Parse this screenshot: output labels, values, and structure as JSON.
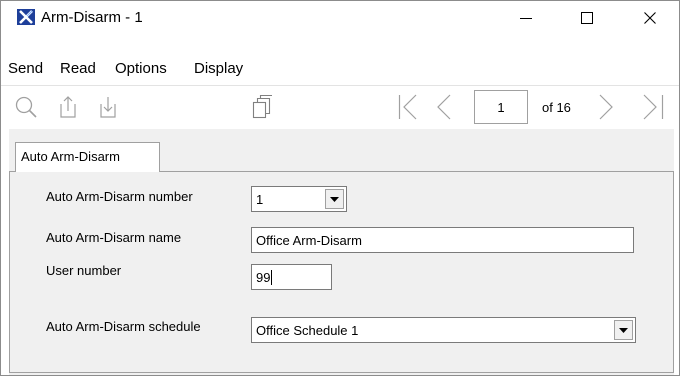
{
  "window": {
    "title": "Arm-Disarm - 1"
  },
  "menu": {
    "items": [
      "Send",
      "Read",
      "Options",
      "Display"
    ]
  },
  "toolbar": {
    "page_value": "1",
    "page_total": "of 16"
  },
  "tab": {
    "label": "Auto Arm-Disarm"
  },
  "form": {
    "number_label": "Auto Arm-Disarm number",
    "number_value": "1",
    "name_label": "Auto Arm-Disarm name",
    "name_value": "Office Arm-Disarm",
    "user_label": "User number",
    "user_value": "99",
    "schedule_label": "Auto Arm-Disarm schedule",
    "schedule_value": "Office Schedule 1"
  },
  "icons": {
    "app": "app-x-icon",
    "minimize": "minimize-icon",
    "maximize": "maximize-icon",
    "close": "close-icon",
    "search": "search-icon",
    "export": "export-icon",
    "import": "import-icon",
    "copy": "copy-icon",
    "first": "first-page-icon",
    "prev": "previous-page-icon",
    "next": "next-page-icon",
    "last": "last-page-icon",
    "dropdown": "dropdown-arrow-icon"
  },
  "colors": {
    "app_icon": "#1e3f9a",
    "panel_bg": "#f0f0f0",
    "disabled_icon": "#a0a0a0"
  }
}
